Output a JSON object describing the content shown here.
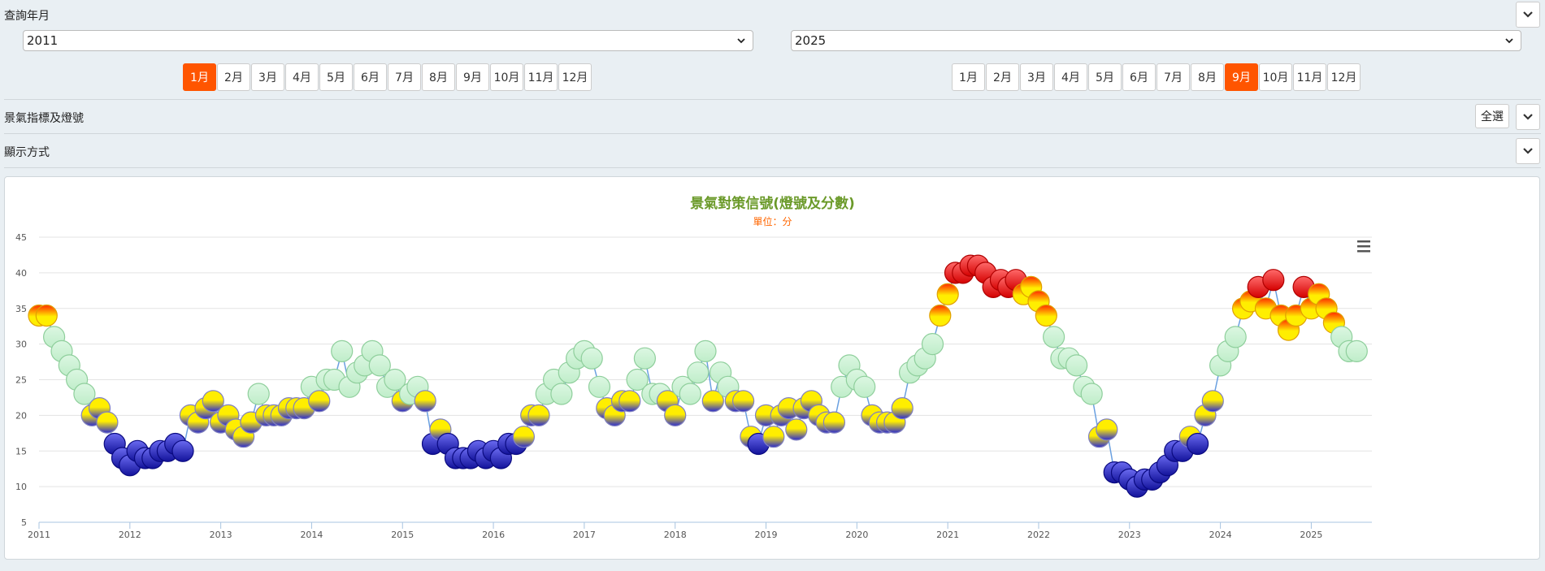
{
  "query": {
    "label": "查詢年月",
    "start_year": "2011",
    "end_year": "2025",
    "months": [
      "1月",
      "2月",
      "3月",
      "4月",
      "5月",
      "6月",
      "7月",
      "8月",
      "9月",
      "10月",
      "11月",
      "12月"
    ],
    "start_month_selected": "1月",
    "end_month_selected": "9月"
  },
  "indicator": {
    "label": "景氣指標及燈號",
    "select_all": "全選"
  },
  "display": {
    "label": "顯示方式"
  },
  "colors": {
    "active": "#ff5500",
    "red": "#e8201a",
    "yellow_red": "#f5a623",
    "green": "#c9f0d0",
    "yellow_blue": "#f0d000",
    "blue": "#2020c0"
  },
  "chart_data": {
    "type": "scatter",
    "title": "景氣對策信號(燈號及分數)",
    "subtitle": "單位：分",
    "ylim": [
      5,
      45
    ],
    "yticks": [
      5,
      10,
      15,
      20,
      25,
      30,
      35,
      40,
      45
    ],
    "xlim": [
      2011.0,
      2025.667
    ],
    "xticks": [
      "2011",
      "2012",
      "2013",
      "2014",
      "2015",
      "2016",
      "2017",
      "2018",
      "2019",
      "2020",
      "2021",
      "2022",
      "2023",
      "2024",
      "2025"
    ],
    "grid": true,
    "series": [
      {
        "values": [
          34,
          34,
          31,
          29,
          27,
          25,
          23,
          20,
          21,
          19,
          16,
          14,
          13,
          15,
          14,
          14,
          15,
          15,
          16,
          15,
          20,
          19,
          21,
          22,
          19,
          20,
          18,
          17,
          19,
          23,
          20,
          20,
          20,
          21,
          21,
          21,
          24,
          22,
          25,
          25,
          29,
          24,
          26,
          27,
          29,
          27,
          24,
          25,
          22,
          23,
          24,
          22,
          16,
          18,
          16,
          14,
          14,
          14,
          15,
          14,
          15,
          14,
          16,
          16,
          17,
          20,
          20,
          23,
          25,
          23,
          26,
          28,
          29,
          28,
          24,
          21,
          20,
          22,
          22,
          25,
          28,
          23,
          23,
          22,
          20,
          24,
          23,
          26,
          29,
          22,
          26,
          24,
          22,
          22,
          17,
          16,
          20,
          17,
          20,
          21,
          18,
          21,
          22,
          20,
          19,
          19,
          24,
          27,
          25,
          24,
          20,
          19,
          19,
          19,
          21,
          26,
          27,
          28,
          30,
          34,
          37,
          40,
          40,
          41,
          41,
          40,
          38,
          39,
          38,
          39,
          37,
          38,
          36,
          34,
          31,
          28,
          28,
          27,
          24,
          23,
          17,
          18,
          12,
          12,
          11,
          10,
          11,
          11,
          12,
          13,
          15,
          15,
          17,
          16,
          20,
          22,
          27,
          29,
          31,
          35,
          36,
          38,
          35,
          39,
          34,
          32,
          34,
          38,
          35,
          37,
          35,
          33,
          31,
          29,
          29
        ],
        "lights": [
          "yr",
          "yr",
          "g",
          "g",
          "g",
          "g",
          "g",
          "yb",
          "yb",
          "yb",
          "b",
          "b",
          "b",
          "b",
          "b",
          "b",
          "b",
          "b",
          "b",
          "b",
          "yb",
          "yb",
          "yb",
          "yb",
          "yb",
          "yb",
          "yb",
          "yb",
          "yb",
          "g",
          "yb",
          "yb",
          "yb",
          "yb",
          "yb",
          "yb",
          "g",
          "yb",
          "g",
          "g",
          "g",
          "g",
          "g",
          "g",
          "g",
          "g",
          "g",
          "g",
          "yb",
          "g",
          "g",
          "yb",
          "b",
          "yb",
          "b",
          "b",
          "b",
          "b",
          "b",
          "b",
          "b",
          "b",
          "b",
          "b",
          "yb",
          "yb",
          "yb",
          "g",
          "g",
          "g",
          "g",
          "g",
          "g",
          "g",
          "g",
          "yb",
          "yb",
          "yb",
          "yb",
          "g",
          "g",
          "g",
          "g",
          "yb",
          "yb",
          "g",
          "g",
          "g",
          "g",
          "yb",
          "g",
          "g",
          "yb",
          "yb",
          "yb",
          "b",
          "yb",
          "yb",
          "yb",
          "yb",
          "yb",
          "yb",
          "yb",
          "yb",
          "yb",
          "yb",
          "g",
          "g",
          "g",
          "g",
          "yb",
          "yb",
          "yb",
          "yb",
          "yb",
          "g",
          "g",
          "g",
          "g",
          "yr",
          "yr",
          "r",
          "r",
          "r",
          "r",
          "r",
          "r",
          "r",
          "r",
          "r",
          "yr",
          "yr",
          "yr",
          "yr",
          "g",
          "g",
          "g",
          "g",
          "g",
          "g",
          "yb",
          "yb",
          "b",
          "b",
          "b",
          "b",
          "b",
          "b",
          "b",
          "b",
          "b",
          "b",
          "yb",
          "b",
          "yb",
          "yb",
          "g",
          "g",
          "g",
          "yr",
          "yr",
          "r",
          "yr",
          "r",
          "yr",
          "yr",
          "yr",
          "r",
          "yr",
          "yr",
          "yr",
          "yr",
          "g",
          "g",
          "g"
        ]
      }
    ]
  }
}
